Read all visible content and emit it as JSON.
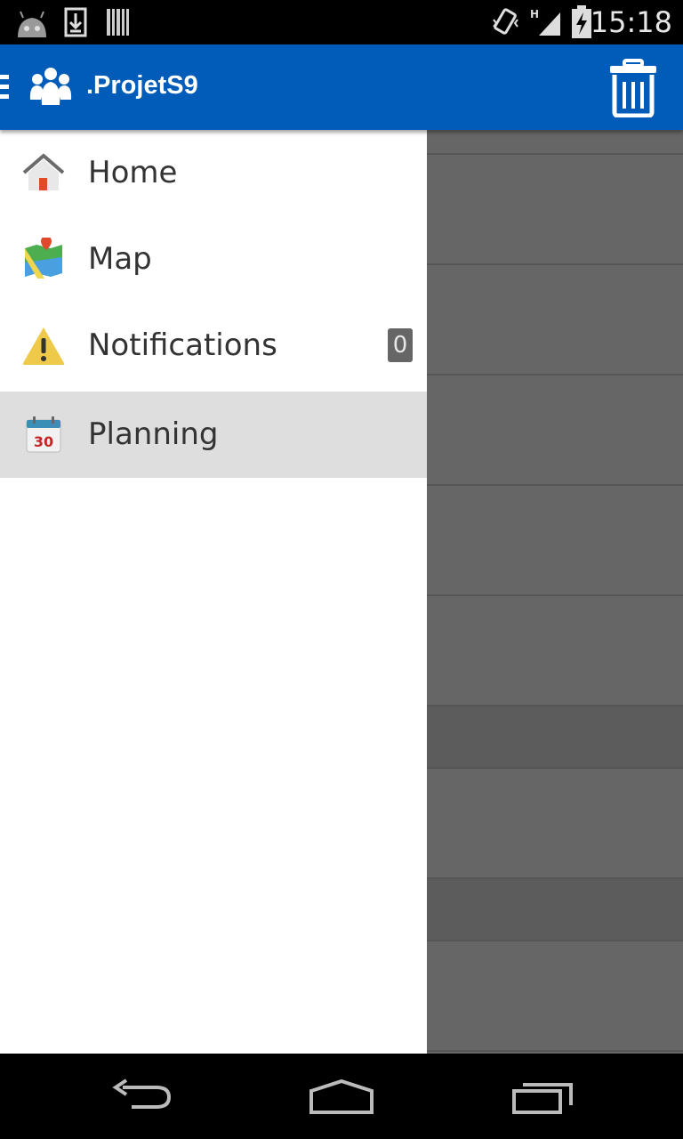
{
  "status_bar": {
    "time": "15:18",
    "icons": [
      "android-icon",
      "download-icon",
      "barcode-icon",
      "vibrate-icon",
      "signal-h-icon",
      "battery-charging-icon"
    ]
  },
  "action_bar": {
    "title": ".ProjetS9",
    "logo_icon": "people-group-icon",
    "action_icon": "trash-icon",
    "color": "#005cb8"
  },
  "drawer": {
    "items": [
      {
        "label": "Home",
        "icon": "home-icon",
        "selected": false
      },
      {
        "label": "Map",
        "icon": "map-icon",
        "selected": false
      },
      {
        "label": "Notifications",
        "icon": "warning-icon",
        "selected": false,
        "count": "0"
      },
      {
        "label": "Planning",
        "icon": "calendar-icon",
        "calendar_day": "30",
        "selected": true
      }
    ]
  },
  "nav_bar": {
    "icons": [
      "back-icon",
      "home-nav-icon",
      "recent-apps-icon"
    ]
  }
}
